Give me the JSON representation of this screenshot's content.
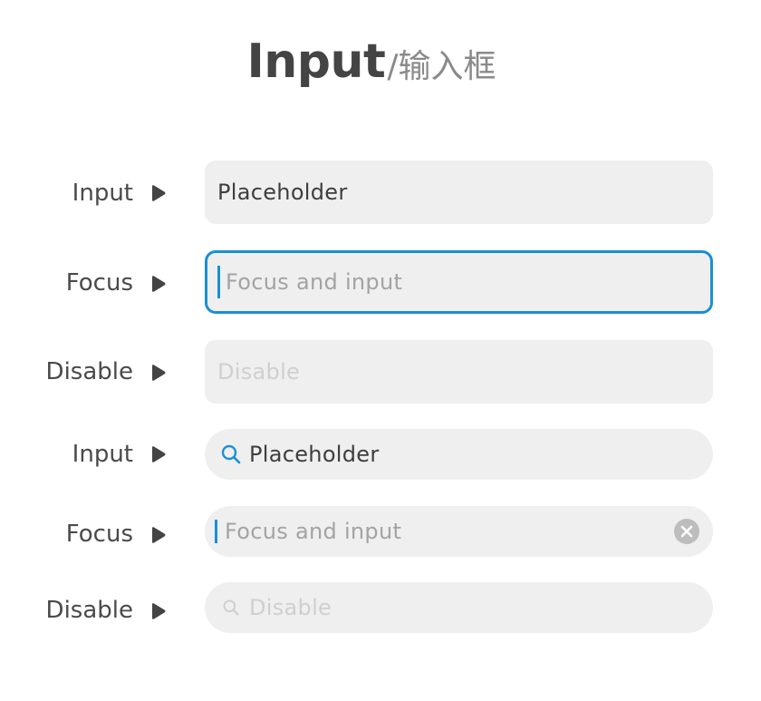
{
  "title": {
    "main": "Input",
    "sub": "/输入框"
  },
  "rows": [
    {
      "label": "Input",
      "text": "Placeholder"
    },
    {
      "label": "Focus",
      "text": "Focus and input"
    },
    {
      "label": "Disable",
      "text": "Disable"
    },
    {
      "label": "Input",
      "text": "Placeholder",
      "icon": "search-icon"
    },
    {
      "label": "Focus",
      "text": "Focus and input",
      "icon": "clear-icon"
    },
    {
      "label": "Disable",
      "text": "Disable",
      "icon": "search-icon"
    }
  ],
  "colors": {
    "accent": "#1a8fd6",
    "field_bg": "#efefef",
    "label": "#4a4a4a",
    "placeholder": "#a3a3a3",
    "disabled": "#cfcfcf"
  }
}
